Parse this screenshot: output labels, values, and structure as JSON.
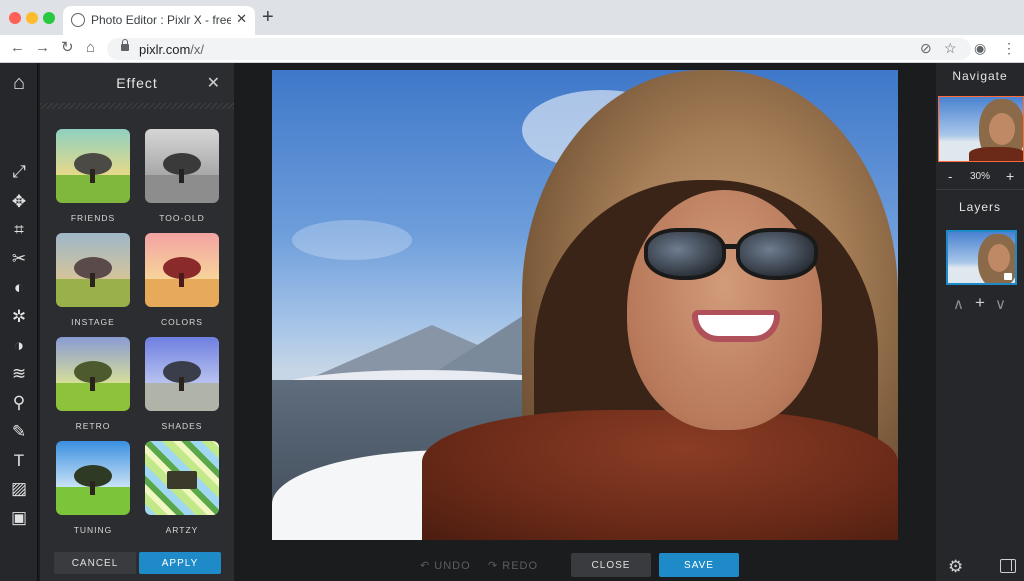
{
  "browser": {
    "tab_title": "Photo Editor : Pixlr X - free ima",
    "tab_close": "✕",
    "new_tab": "+",
    "url_host": "pixlr.com",
    "url_path": "/x/",
    "back": "←",
    "forward": "→",
    "reload": "↻",
    "home": "⌂",
    "star": "☆",
    "account": "◉",
    "menu": "⋮"
  },
  "effect_panel": {
    "title": "Effect",
    "close": "✕",
    "effects": [
      {
        "label": "FRIENDS"
      },
      {
        "label": "TOO-OLD"
      },
      {
        "label": "INSTAGE"
      },
      {
        "label": "COLORS"
      },
      {
        "label": "RETRO"
      },
      {
        "label": "SHADES"
      },
      {
        "label": "TUNING"
      },
      {
        "label": "ARTZY"
      }
    ],
    "cancel_label": "CANCEL",
    "apply_label": "APPLY"
  },
  "canvas": {
    "undo_label": "↶ UNDO",
    "redo_label": "↷ REDO",
    "close_label": "CLOSE",
    "save_label": "SAVE"
  },
  "right_panel": {
    "navigate_title": "Navigate",
    "zoom_minus": "-",
    "zoom_value": "30%",
    "zoom_plus": "+",
    "layers_title": "Layers",
    "layer_up": "∧",
    "layer_add": "+",
    "layer_down": "∨",
    "settings": "⚙"
  },
  "tools": {
    "home": "⌂",
    "arrange": "⤢",
    "move": "✥",
    "crop": "⌗",
    "cutout": "✂",
    "adjust": "◐",
    "filter": "✲",
    "effect": "◑",
    "liquify": "≋",
    "retouch": "⚲",
    "draw": "✎",
    "text": "T",
    "element": "▨",
    "image": "▣"
  },
  "colors": {
    "accent": "#1f8ac8",
    "highlight": "#ff6a3d"
  }
}
